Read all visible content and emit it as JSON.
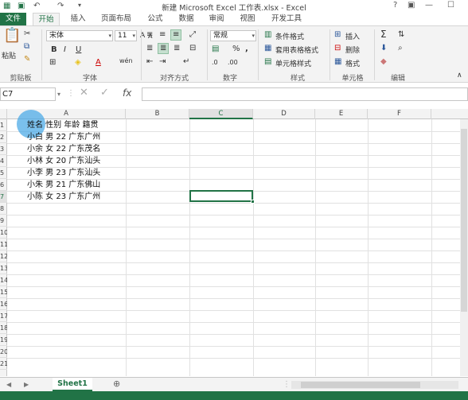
{
  "title": "新建 Microsoft Excel 工作表.xlsx - Excel",
  "window_buttons": [
    "?",
    "▣",
    "—",
    "☐"
  ],
  "tabs": {
    "file": "文件",
    "items": [
      "开始",
      "插入",
      "页面布局",
      "公式",
      "数据",
      "审阅",
      "视图",
      "开发工具"
    ],
    "active": "开始"
  },
  "ribbon": {
    "clipboard": {
      "paste": "粘贴",
      "label": "剪贴板"
    },
    "font": {
      "family": "宋体",
      "size": "11",
      "label": "字体"
    },
    "alignment": {
      "label": "对齐方式"
    },
    "number": {
      "format": "常规",
      "label": "数字"
    },
    "styles": {
      "conditional": "条件格式",
      "table": "套用表格格式",
      "cell": "单元格样式",
      "label": "样式"
    },
    "cells": {
      "insert": "插入",
      "delete": "删除",
      "format": "格式",
      "label": "单元格"
    },
    "editing": {
      "label": "编辑"
    }
  },
  "formula_bar": {
    "name_box": "C7",
    "formula": ""
  },
  "columns": [
    "A",
    "B",
    "C",
    "D",
    "E",
    "F"
  ],
  "rows": [
    "1",
    "2",
    "3",
    "4",
    "5",
    "6",
    "7",
    "8",
    "9",
    "10",
    "11",
    "12",
    "13",
    "14",
    "15",
    "16",
    "17",
    "18",
    "19",
    "20",
    "21"
  ],
  "cells": [
    "姓名 性别 年龄 籍贯",
    "小白 男 22 广东广州",
    "小余 女 22 广东茂名",
    "小林 女 20 广东汕头",
    "小李 男 23 广东汕头",
    "小朱 男 21 广东佛山",
    "小陈 女 23 广东广州"
  ],
  "sheet": {
    "name": "Sheet1"
  },
  "colors": {
    "accent": "#217346"
  }
}
